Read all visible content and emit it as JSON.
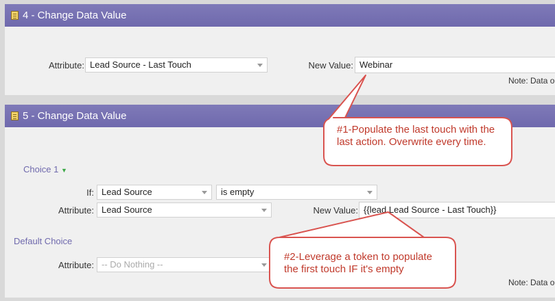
{
  "step4": {
    "title": "4 - Change Data Value",
    "attribute_label": "Attribute:",
    "attribute_value": "Lead Source - Last Touch",
    "new_value_label": "New Value:",
    "new_value": "Webinar",
    "note": "Note: Data o"
  },
  "step5": {
    "title": "5 - Change Data Value",
    "choice_label": "Choice 1",
    "if_label": "If:",
    "if_field": "Lead Source",
    "if_operator": "is empty",
    "attribute_label": "Attribute:",
    "attribute_value": "Lead Source",
    "new_value_label": "New Value:",
    "new_value": "{{lead.Lead Source - Last Touch}}",
    "default_choice_label": "Default Choice",
    "default_attribute_label": "Attribute:",
    "default_attribute_value": "-- Do Nothing --",
    "note": "Note: Data o"
  },
  "callouts": {
    "one": "#1-Populate the last touch with the last action. Overwrite every time.",
    "two": "#2-Leverage a token to populate the first touch IF it's empty"
  },
  "colors": {
    "header": "#6f69ad",
    "callout_border": "#d9534f",
    "callout_text": "#c0392b"
  }
}
